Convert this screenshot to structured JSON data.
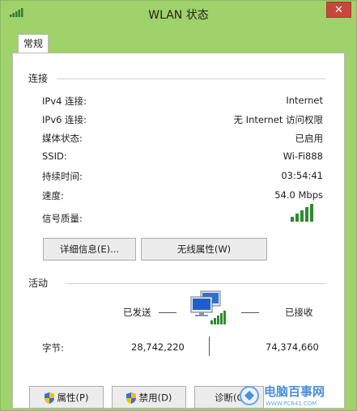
{
  "window": {
    "title": "WLAN 状态",
    "close_glyph": "✕",
    "accent": "#9fd26a"
  },
  "tabs": [
    {
      "label": "常规"
    }
  ],
  "connection": {
    "heading": "连接",
    "rows": [
      {
        "label": "IPv4 连接:",
        "value": "Internet"
      },
      {
        "label": "IPv6 连接:",
        "value": "无 Internet 访问权限"
      },
      {
        "label": "媒体状态:",
        "value": "已启用"
      },
      {
        "label": "SSID:",
        "value": "Wi-Fi888"
      },
      {
        "label": "持续时间:",
        "value": "03:54:41"
      },
      {
        "label": "速度:",
        "value": "54.0 Mbps"
      },
      {
        "label": "信号质量:",
        "value": ""
      }
    ],
    "signal_icon": "signal-bars-icon",
    "signal_level": 5,
    "details_button": "详细信息(E)...",
    "wireless_props_button": "无线属性(W)"
  },
  "activity": {
    "heading": "活动",
    "sent_label": "已发送",
    "received_label": "已接收",
    "bytes_label": "字节:",
    "sent_value": "28,742,220",
    "received_value": "74,374,660",
    "network_icon": "network-computers-icon"
  },
  "footer": {
    "properties_button": "属性(P)",
    "disable_button": "禁用(D)",
    "diagnose_button": "诊断(G)",
    "shield_icon": "uac-shield-icon"
  },
  "watermark": {
    "text": "电脑百事网",
    "url": "WWW.PC841.COM"
  }
}
